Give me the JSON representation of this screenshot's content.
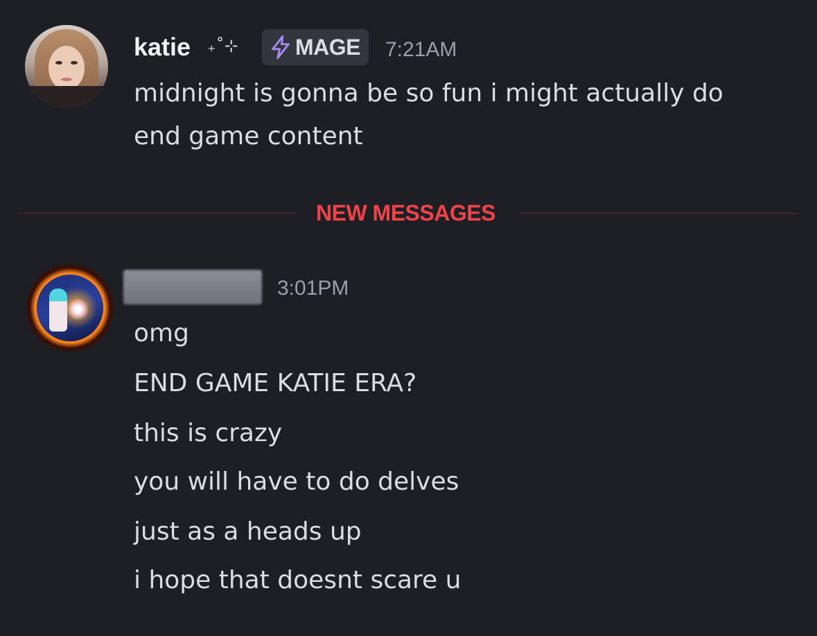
{
  "messages": [
    {
      "author": "katie",
      "name_decoration": "₊˚⊹",
      "role": "MAGE",
      "role_icon": "lightning-bolt-icon",
      "role_color": "#a98cf2",
      "timestamp": "7:21AM",
      "lines": [
        "midnight is gonna be so fun i might actually do",
        "end game content"
      ]
    },
    {
      "author": "",
      "author_redacted": true,
      "timestamp": "3:01PM",
      "lines": [
        "omg",
        "END GAME KATIE ERA?",
        "this is crazy",
        "you will have to do delves",
        "just as a heads up",
        "i hope that doesnt scare u"
      ]
    }
  ],
  "divider": {
    "label": "NEW MESSAGES",
    "color": "#f04349"
  },
  "colors": {
    "background": "#1e1f24",
    "text": "#dbdee1",
    "timestamp": "#9aa0a8"
  }
}
